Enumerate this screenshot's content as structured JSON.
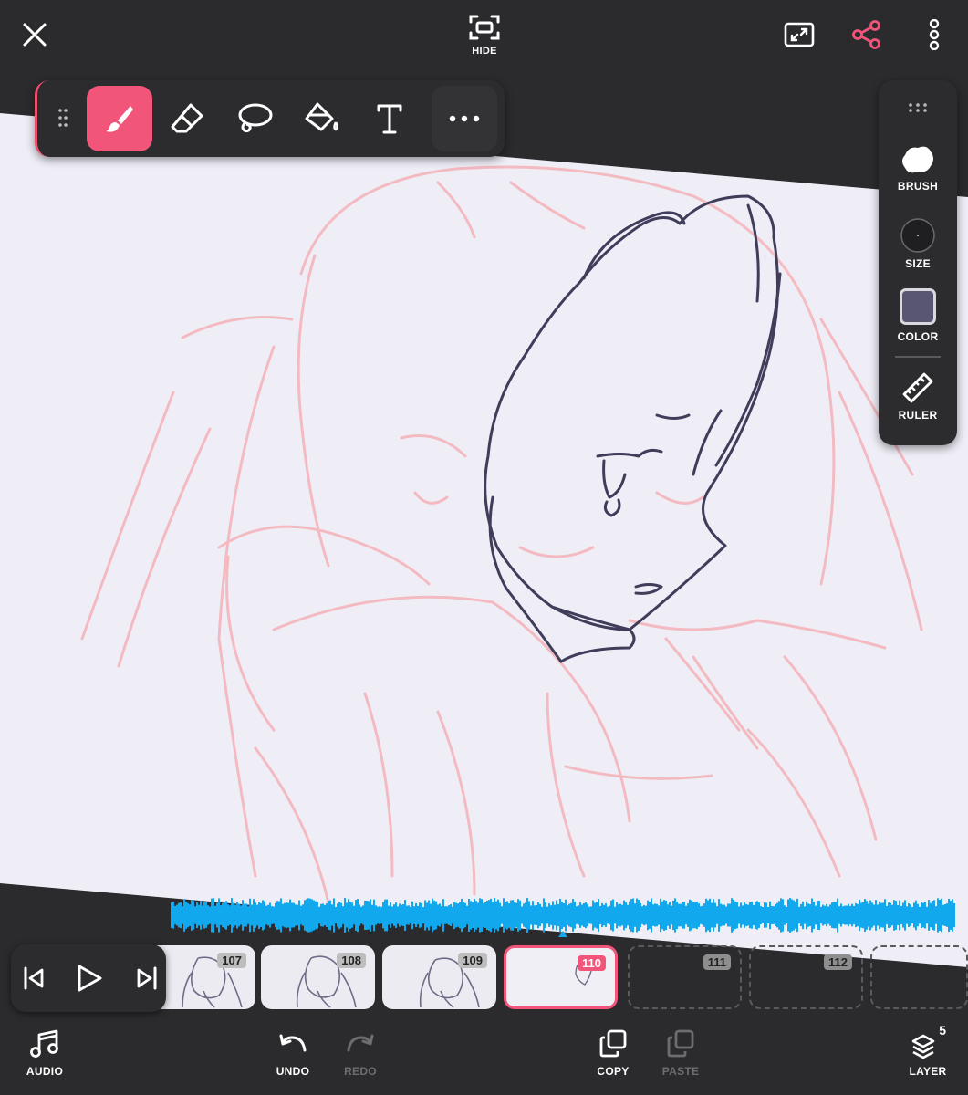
{
  "top_bar": {
    "close_icon": "close-icon",
    "hide_label": "HIDE",
    "fullscreen_icon": "expand-icon",
    "share_icon": "share-icon",
    "more_icon": "more-vertical-icon"
  },
  "tool_palette": {
    "tools": [
      {
        "name": "brush",
        "icon": "brush-icon",
        "active": true
      },
      {
        "name": "eraser",
        "icon": "eraser-icon",
        "active": false
      },
      {
        "name": "lasso",
        "icon": "lasso-icon",
        "active": false
      },
      {
        "name": "fill",
        "icon": "paint-bucket-icon",
        "active": false
      },
      {
        "name": "text",
        "icon": "text-icon",
        "active": false
      },
      {
        "name": "more",
        "icon": "more-horizontal-icon",
        "active": false
      }
    ]
  },
  "right_panel": {
    "brush_label": "BRUSH",
    "size_label": "SIZE",
    "color_label": "COLOR",
    "ruler_label": "RULER",
    "current_color": "#595674"
  },
  "timeline": {
    "frames": [
      {
        "number": "107",
        "state": "drawn"
      },
      {
        "number": "108",
        "state": "drawn"
      },
      {
        "number": "109",
        "state": "drawn"
      },
      {
        "number": "110",
        "state": "current"
      },
      {
        "number": "111",
        "state": "empty"
      },
      {
        "number": "112",
        "state": "empty"
      }
    ],
    "waveform_color": "#12a8ee"
  },
  "bottom_bar": {
    "audio_label": "AUDIO",
    "undo_label": "UNDO",
    "redo_label": "REDO",
    "copy_label": "COPY",
    "paste_label": "PASTE",
    "layer_label": "LAYER",
    "layer_count": "5"
  },
  "colors": {
    "accent": "#f2557a",
    "bar_background": "#2b2b2d",
    "canvas_paper": "#efeef7",
    "onion_skin": "#f4b8bf",
    "ink": "#3f3d5a"
  }
}
